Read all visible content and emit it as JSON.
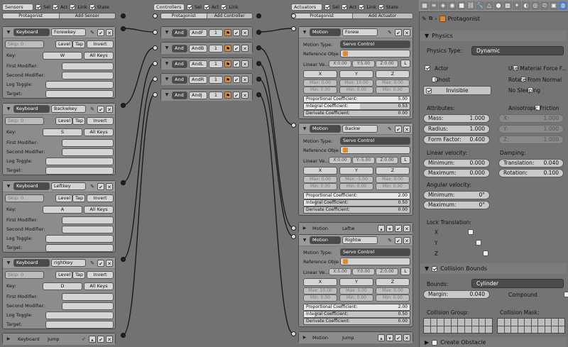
{
  "sensors_header": {
    "select": "Sensors",
    "checks": [
      "Sel",
      "Act",
      "Link",
      "State"
    ],
    "object": "Protagonist",
    "add": "Add Sensor"
  },
  "controllers_header": {
    "select": "Controllers",
    "checks": [
      "Sel",
      "Act",
      "Link"
    ],
    "object": "Protagonist",
    "add": "Add Controller"
  },
  "actuators_header": {
    "select": "Actuators",
    "checks": [
      "Sel",
      "Act",
      "Link",
      "State"
    ],
    "object": "Protagonist",
    "add": "Add Actuator"
  },
  "sensors": [
    {
      "type": "Keyboard",
      "name": "Forewkey",
      "skip": "Skip: 0",
      "level": "Level",
      "tap": "Tap",
      "invert": "Invert",
      "key_label": "Key:",
      "key": "W",
      "all_keys": "All Keys",
      "first_mod": "First Modifier:",
      "second_mod": "Second Modifier:",
      "log_toggle": "Log Toggle:",
      "target": "Target:"
    },
    {
      "type": "Keyboard",
      "name": "Backwkey",
      "skip": "Skip: 0",
      "level": "Level",
      "tap": "Tap",
      "invert": "Invert",
      "key_label": "Key:",
      "key": "S",
      "all_keys": "All Keys",
      "first_mod": "First Modifier:",
      "second_mod": "Second Modifier:",
      "log_toggle": "Log Toggle:",
      "target": "Target:"
    },
    {
      "type": "Keyboard",
      "name": "Leftkey",
      "skip": "Skip: 0",
      "level": "Level",
      "tap": "Tap",
      "invert": "Invert",
      "key_label": "Key:",
      "key": "A",
      "all_keys": "All Keys",
      "first_mod": "First Modifier:",
      "second_mod": "Second Modifier:",
      "log_toggle": "Log Toggle:",
      "target": "Target:"
    },
    {
      "type": "Keyboard",
      "name": "rightkey",
      "skip": "Skip: 0",
      "level": "Level",
      "tap": "Tap",
      "invert": "Invert",
      "key_label": "Key:",
      "key": "D",
      "all_keys": "All Keys",
      "first_mod": "First Modifier:",
      "second_mod": "Second Modifier:",
      "log_toggle": "Log Toggle:",
      "target": "Target:"
    }
  ],
  "sensor_collapsed": {
    "type": "Keyboard",
    "name": "Jump"
  },
  "controllers": [
    {
      "type": "And",
      "name": "AndF",
      "state": "1"
    },
    {
      "type": "And",
      "name": "AndB",
      "state": "1"
    },
    {
      "type": "And",
      "name": "AndL",
      "state": "1"
    },
    {
      "type": "And",
      "name": "AndR",
      "state": "1"
    },
    {
      "type": "And",
      "name": "AndJ",
      "state": "1"
    }
  ],
  "actuators": [
    {
      "type": "Motion",
      "name": "Forew",
      "motion_type_label": "Motion Type:",
      "motion_type": "Servo Control",
      "ref_label": "Reference Obje",
      "lv_label": "Linear Ve...",
      "x": "X:0.00",
      "y": "Y:5.00",
      "z": "Z:0.00",
      "l": "L",
      "axes": [
        "X",
        "Y",
        "Z"
      ],
      "max": [
        "Max: 0.00",
        "Max: 10.00",
        "Max: 0.00"
      ],
      "min": [
        "Min: 0.00",
        "Min: 0.00",
        "Min: 0.00"
      ],
      "prop_label": "Proportional Coefficient:",
      "prop": "5.00",
      "prop_frac": 1.0,
      "int_label": "Integral Coefficient:",
      "int": "0.53",
      "int_frac": 0.53,
      "der_label": "Derivate Coefficient:",
      "der": "0.00",
      "der_frac": 0.0
    },
    {
      "type": "Motion",
      "name": "Backw",
      "motion_type_label": "Motion Type:",
      "motion_type": "Servo Control",
      "ref_label": "Reference Obje",
      "lv_label": "Linear Ve...",
      "x": "X:0.00",
      "y": "Y:-5.00",
      "z": "Z:0.00",
      "l": "L",
      "axes": [
        "X",
        "Y",
        "Z"
      ],
      "max": [
        "Max: 0.00",
        "Max: -5.00",
        "Max: 0.00"
      ],
      "min": [
        "Min: 0.00",
        "Min: 0.00",
        "Min: 0.00"
      ],
      "prop_label": "Proportional Coefficient:",
      "prop": "2.00",
      "prop_frac": 1.0,
      "int_label": "Integral Coefficient:",
      "int": "0.50",
      "int_frac": 0.1,
      "der_label": "Derivate Coefficient:",
      "der": "0.00",
      "der_frac": 0.0
    },
    {
      "type": "Motion",
      "name": "Rightw",
      "motion_type_label": "Motion Type:",
      "motion_type": "Servo Control",
      "ref_label": "Reference Obje",
      "lv_label": "Linear Ve...",
      "x": "X:5.00",
      "y": "Y:0.00",
      "z": "Z:0.00",
      "l": "L",
      "axes": [
        "X",
        "Y",
        "Z"
      ],
      "max": [
        "Max: 10.00",
        "Max: 0.00",
        "Max: 0.00"
      ],
      "min": [
        "Min: 0.00",
        "Min: 0.00",
        "Min: 0.00"
      ],
      "prop_label": "Proportional Coefficient:",
      "prop": "2.00",
      "prop_frac": 1.0,
      "int_label": "Integral Coefficient:",
      "int": "0.50",
      "int_frac": 0.1,
      "der_label": "Derivate Coefficient:",
      "der": "0.00",
      "der_frac": 0.0
    }
  ],
  "actuator_collapsed": [
    {
      "type": "Motion",
      "name": "Leftw"
    },
    {
      "type": "Motion",
      "name": "Jump"
    }
  ],
  "props": {
    "object_name": "Protagonist",
    "physics_title": "Physics",
    "physics_type_label": "Physics Type:",
    "physics_type": "Dynamic",
    "actor": "Actor",
    "ghost": "Ghost",
    "invisible": "Invisible",
    "use_material_force": "Use Material Force F...",
    "rotate_from_normal": "Rotate From Normal",
    "no_sleeping": "No Sleeping",
    "attributes": "Attributes:",
    "mass_label": "Mass:",
    "mass": "1.000",
    "radius_label": "Radius:",
    "radius": "1.000",
    "form_label": "Form Factor:",
    "form": "0.400",
    "aniso": "Anisotropic Friction",
    "ax_label": "X:",
    "ax": "1.000",
    "ay_label": "Y:",
    "ay": "1.000",
    "az_label": "Z:",
    "az": "1.000",
    "linvel": "Linear velocity:",
    "lmin_label": "Minimum:",
    "lmin": "0.000",
    "lmax_label": "Maximum:",
    "lmax": "0.000",
    "damping": "Damping:",
    "dtrans_label": "Translation:",
    "dtrans": "0.040",
    "drot_label": "Rotation:",
    "drot": "0.100",
    "angvel": "Angular velocity:",
    "amin_label": "Minimum:",
    "amin": "0°",
    "amax_label": "Maximum:",
    "amax": "0°",
    "lock_title": "Lock Translation:",
    "lx": "X",
    "ly": "Y",
    "lz": "Z",
    "collision_title": "Collision Bounds",
    "bounds_label": "Bounds:",
    "bounds": "Cylinder",
    "margin_label": "Margin:",
    "margin": "0.040",
    "compound": "Compound",
    "coll_group": "Collision Group:",
    "coll_mask": "Collision Mask:",
    "obstacle_title": "Create Obstacle"
  }
}
